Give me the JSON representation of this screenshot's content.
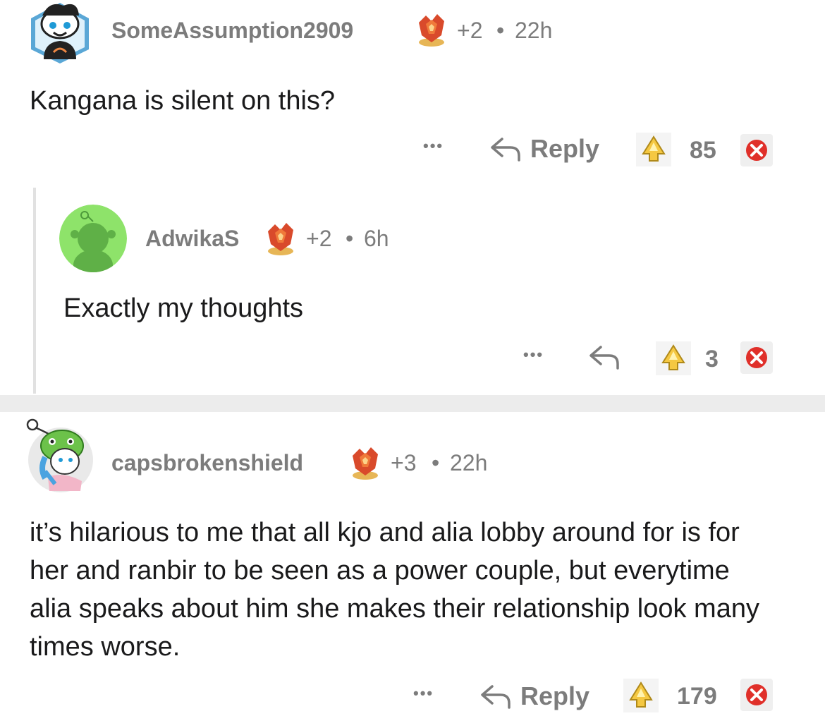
{
  "comments": [
    {
      "username": "SomeAssumption2909",
      "award_count": "+2",
      "separator": "•",
      "time": "22h",
      "body": "Kangana is silent on this?",
      "more_label": "•••",
      "reply_label": "Reply",
      "score": "85"
    },
    {
      "username": "AdwikaS",
      "award_count": "+2",
      "separator": "•",
      "time": "6h",
      "body": "Exactly my thoughts",
      "more_label": "•••",
      "score": "3"
    },
    {
      "username": "capsbrokenshield",
      "award_count": "+3",
      "separator": "•",
      "time": "22h",
      "body": "it’s hilarious to me that all kjo and alia lobby around for is for her and ranbir to be seen as a power couple, but everytime alia speaks about him she makes their relationship look many times worse.",
      "more_label": "•••",
      "reply_label": "Reply",
      "score": "179"
    }
  ],
  "colors": {
    "text": "#1a1a1b",
    "meta": "#7c7c7c",
    "award_red": "#d94a2b",
    "upvote_yellow": "#f5c842",
    "downvote_red": "#e0302a"
  },
  "icons": {
    "award": "fire-crystal-award-icon",
    "upvote": "gold-upvote-icon",
    "downvote": "red-x-downvote-icon",
    "reply": "reply-arrow-icon"
  }
}
